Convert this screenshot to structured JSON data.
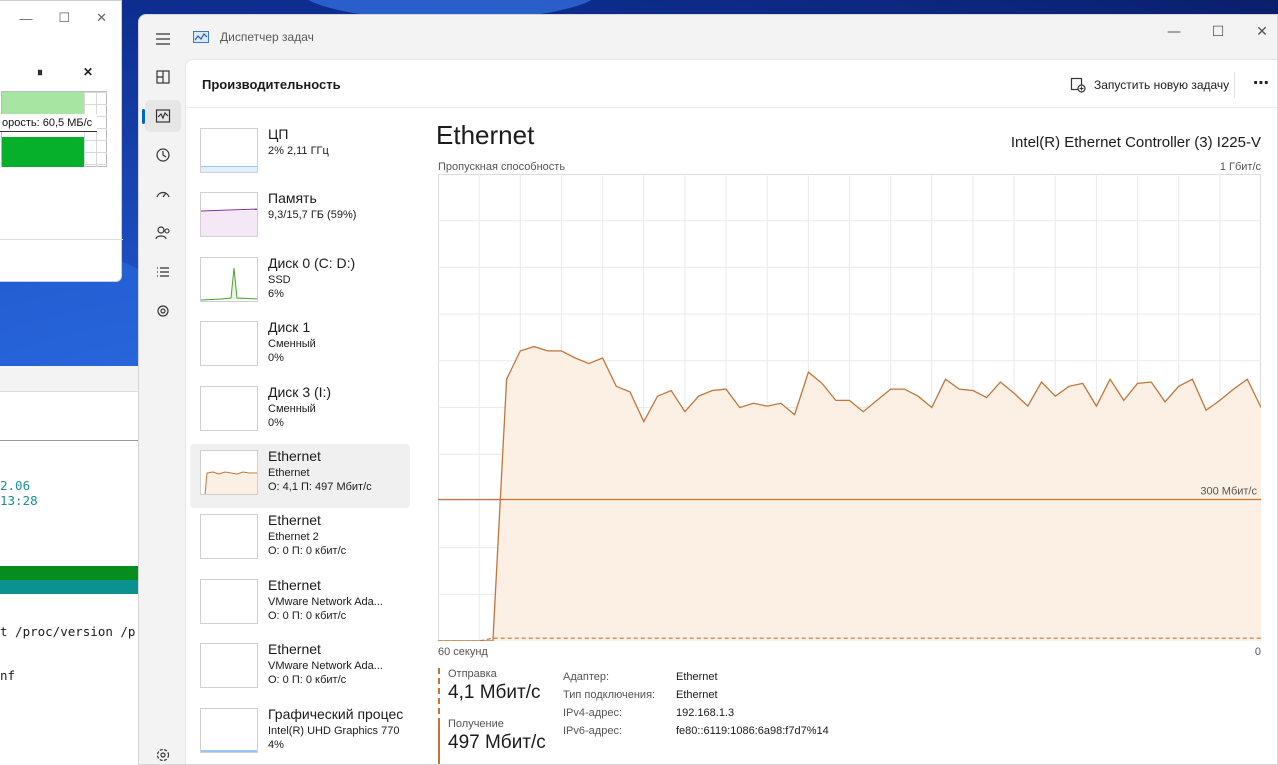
{
  "copy_dialog": {
    "minimize": "—",
    "maximize": "☐",
    "close": "✕",
    "pause": "⏸",
    "cancel": "✕",
    "speed_label": "орость: 60,5 МБ/с"
  },
  "terminal": {
    "line1": "2.06",
    "line2": "13:28",
    "line3": "t /proc/version /p",
    "line4": "nf"
  },
  "window": {
    "title": "Диспетчер задач",
    "minimize": "—",
    "maximize": "☐",
    "close": "✕"
  },
  "rail": [
    "menu-icon",
    "processes-icon",
    "performance-icon",
    "app-history-icon",
    "startup-icon",
    "users-icon",
    "details-icon",
    "services-icon",
    "settings-icon"
  ],
  "header": {
    "title": "Производительность",
    "run_task": "Запустить новую задачу",
    "more": "⋯"
  },
  "devices": [
    {
      "name": "ЦП",
      "line1": "2% 2,11 ГГц",
      "line2": ""
    },
    {
      "name": "Память",
      "line1": "9,3/15,7 ГБ (59%)",
      "line2": ""
    },
    {
      "name": "Диск 0 (C: D:)",
      "line1": "SSD",
      "line2": "6%"
    },
    {
      "name": "Диск 1",
      "line1": "Сменный",
      "line2": "0%"
    },
    {
      "name": "Диск 3 (I:)",
      "line1": "Сменный",
      "line2": "0%"
    },
    {
      "name": "Ethernet",
      "line1": "Ethernet",
      "line2": "О: 4,1 П: 497 Мбит/с"
    },
    {
      "name": "Ethernet",
      "line1": "Ethernet 2",
      "line2": "О: 0 П: 0 кбит/с"
    },
    {
      "name": "Ethernet",
      "line1": "VMware Network Ada...",
      "line2": "О: 0 П: 0 кбит/с"
    },
    {
      "name": "Ethernet",
      "line1": "VMware Network Ada...",
      "line2": "О: 0 П: 0 кбит/с"
    },
    {
      "name": "Графический процес",
      "line1": "Intel(R) UHD Graphics 770",
      "line2": "4%"
    }
  ],
  "detail": {
    "title": "Ethernet",
    "adapter": "Intel(R) Ethernet Controller (3) I225-V",
    "capacity_label": "Пропускная способность",
    "capacity_max": "1 Гбит/с",
    "scale_line_label": "300 Мбит/с",
    "time_left": "60 секунд",
    "time_right": "0",
    "send_label": "Отправка",
    "send_value": "4,1 Мбит/с",
    "recv_label": "Получение",
    "recv_value": "497 Мбит/с",
    "props": [
      {
        "k": "Адаптер:",
        "v": "Ethernet"
      },
      {
        "k": "Тип подключения:",
        "v": "Ethernet"
      },
      {
        "k": "IPv4-адрес:",
        "v": "192.168.1.3"
      },
      {
        "k": "IPv6-адрес:",
        "v": "fe80::6119:1086:6a98:f7d7%14"
      }
    ],
    "colors": {
      "line": "#c2753a",
      "fill": "#fcefe3",
      "grid": "#eaeaea"
    }
  },
  "chart_data": {
    "type": "area",
    "xlabel": "",
    "ylabel": "",
    "y_unit": "Мбит/с",
    "ylim": [
      0,
      330
    ],
    "x": [
      60,
      59,
      58,
      57,
      56,
      55,
      54,
      53,
      52,
      51,
      50,
      49,
      48,
      47,
      46,
      45,
      44,
      43,
      42,
      41,
      40,
      39,
      38,
      37,
      36,
      35,
      34,
      33,
      32,
      31,
      30,
      29,
      28,
      27,
      26,
      25,
      24,
      23,
      22,
      21,
      20,
      19,
      18,
      17,
      16,
      15,
      14,
      13,
      12,
      11,
      10,
      9,
      8,
      7,
      6,
      5,
      4,
      3,
      2,
      1,
      0
    ],
    "series": [
      {
        "name": "Получение",
        "values": [
          0,
          0,
          0,
          0,
          0,
          185,
          205,
          208,
          205,
          205,
          200,
          196,
          200,
          180,
          176,
          155,
          173,
          177,
          162,
          173,
          177,
          178,
          165,
          168,
          166,
          168,
          160,
          190,
          182,
          170,
          170,
          162,
          170,
          178,
          178,
          173,
          165,
          185,
          178,
          177,
          172,
          183,
          175,
          166,
          183,
          173,
          180,
          182,
          166,
          185,
          170,
          182,
          183,
          169,
          180,
          185,
          163,
          170,
          178,
          185,
          165
        ],
        "style": "solid"
      },
      {
        "name": "Отправка",
        "values": [
          0,
          0,
          0,
          0,
          2,
          2,
          2,
          2,
          2,
          2,
          2,
          2,
          2,
          2,
          2,
          2,
          2,
          2,
          2,
          2,
          2,
          2,
          2,
          2,
          2,
          2,
          2,
          2,
          2,
          2,
          2,
          2,
          2,
          2,
          2,
          2,
          2,
          2,
          2,
          2,
          2,
          2,
          2,
          2,
          2,
          2,
          2,
          2,
          2,
          2,
          2,
          2,
          2,
          2,
          2,
          2,
          2,
          2,
          2,
          2,
          2
        ],
        "style": "dashed"
      }
    ],
    "reference_line": {
      "value": 100,
      "label": "300 Мбит/с"
    }
  }
}
